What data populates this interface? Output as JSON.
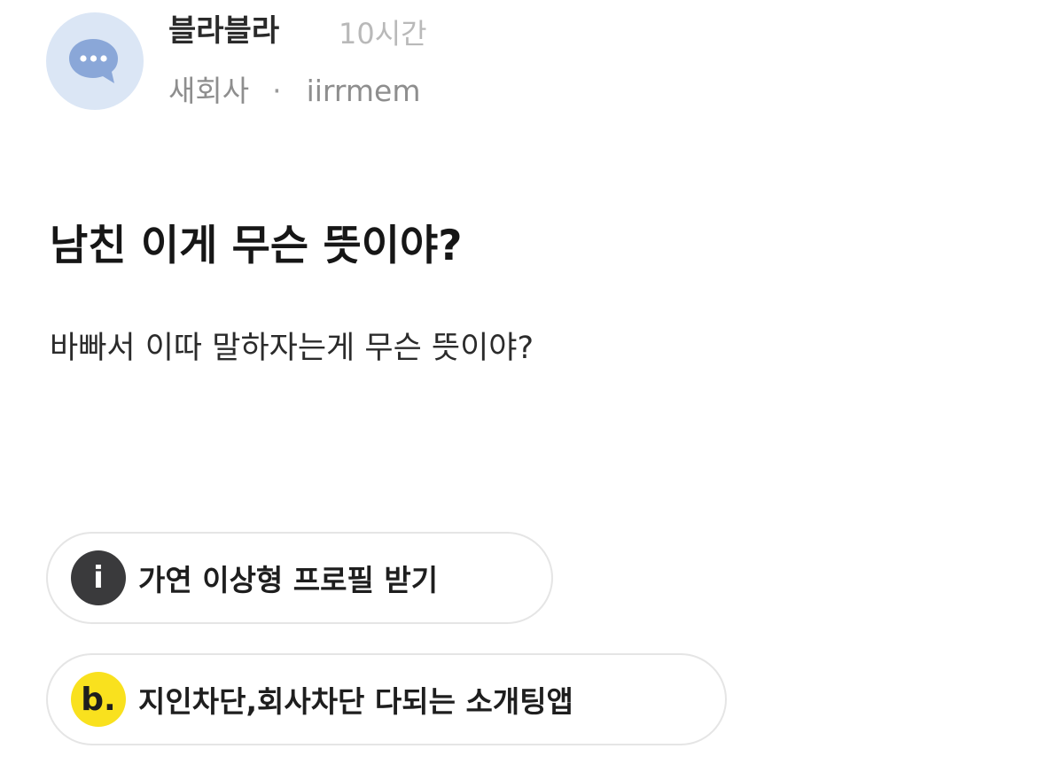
{
  "post": {
    "author": {
      "name": "블라블라",
      "company": "새회사",
      "separator": "·",
      "handle": "iirrmem",
      "avatar_icon": "chat-bubble-icon"
    },
    "time": "10시간",
    "title": "남친 이게 무슨 뜻이야?",
    "body": "바빠서 이따 말하자는게 무슨 뜻이야?"
  },
  "promos": [
    {
      "icon": "info-icon",
      "icon_glyph": "i",
      "label": "가연 이상형 프로필 받기"
    },
    {
      "icon": "brand-b-icon",
      "icon_glyph": "b.",
      "label": "지인차단,회사차단 다되는 소개팅앱"
    }
  ],
  "colors": {
    "avatar_bg": "#dbe6f5",
    "avatar_icon": "#8aa7d8",
    "info_icon_bg": "#3a3a3c",
    "brand_icon_bg": "#f9e11e"
  }
}
